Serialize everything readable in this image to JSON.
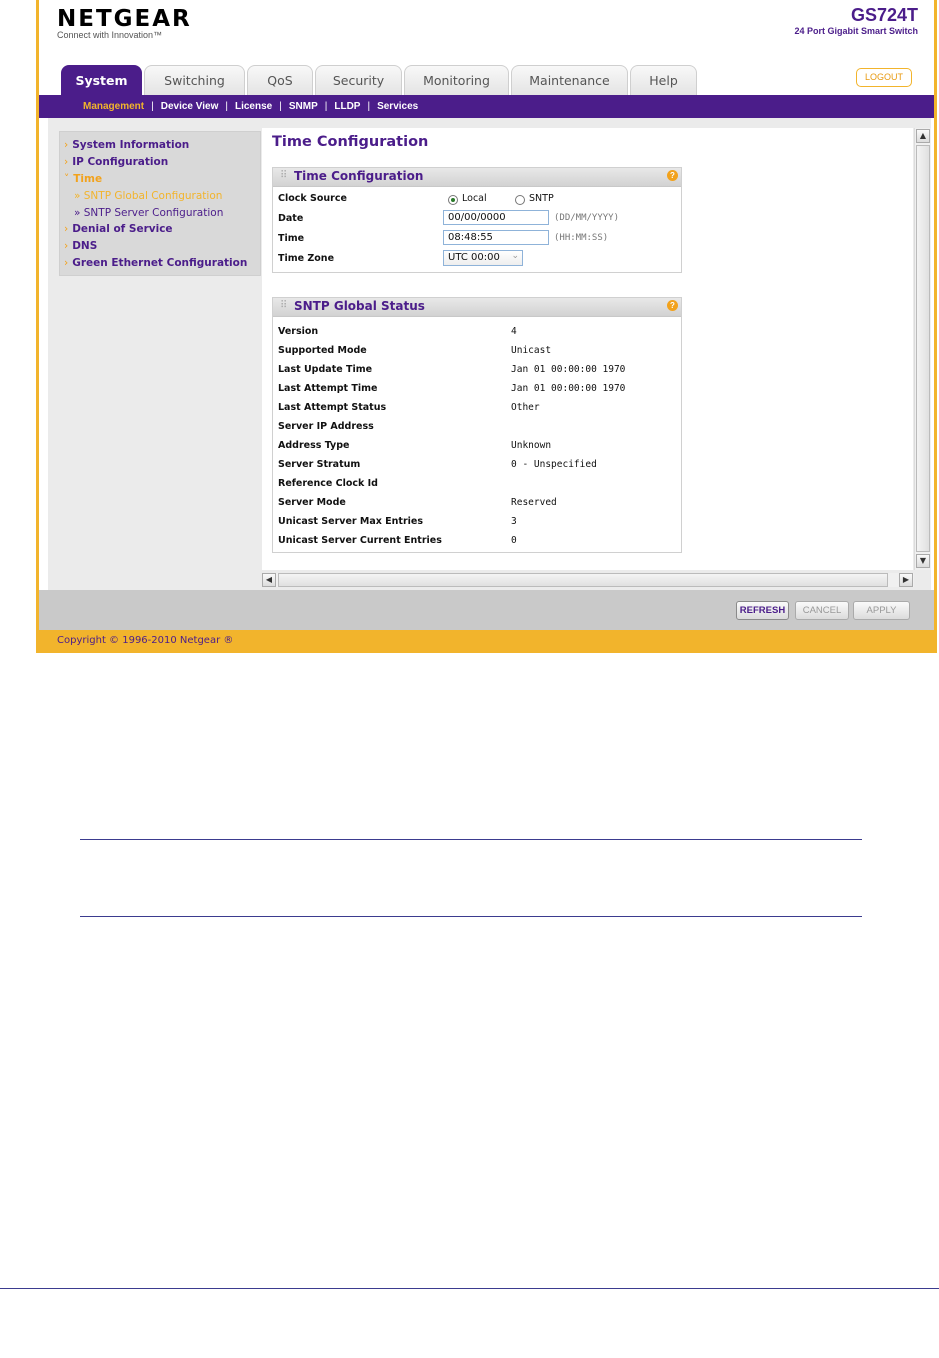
{
  "header": {
    "logo": "NETGEAR",
    "tagline": "Connect with Innovation™",
    "model": "GS724T",
    "model_desc": "24 Port Gigabit Smart Switch",
    "logout": "LOGOUT"
  },
  "tabs": [
    "System",
    "Switching",
    "QoS",
    "Security",
    "Monitoring",
    "Maintenance",
    "Help"
  ],
  "subnav": [
    "Management",
    "Device View",
    "License",
    "SNMP",
    "LLDP",
    "Services"
  ],
  "leftnav": {
    "system_info": "System Information",
    "ip_config": "IP Configuration",
    "time": "Time",
    "sntp_global": "» SNTP Global Configuration",
    "sntp_server": "» SNTP Server Configuration",
    "dos": "Denial of Service",
    "dns": "DNS",
    "green": "Green Ethernet Configuration"
  },
  "page_title": "Time Configuration",
  "time_config": {
    "title": "Time Configuration",
    "clock_source_label": "Clock Source",
    "local": "Local",
    "sntp": "SNTP",
    "date_label": "Date",
    "date_value": "00/00/0000",
    "date_hint": "(DD/MM/YYYY)",
    "time_label": "Time",
    "time_value": "08:48:55",
    "time_hint": "(HH:MM:SS)",
    "tz_label": "Time Zone",
    "tz_value": "UTC 00:00"
  },
  "sntp_status": {
    "title": "SNTP Global Status",
    "rows": [
      {
        "label": "Version",
        "value": "4"
      },
      {
        "label": "Supported Mode",
        "value": "Unicast"
      },
      {
        "label": "Last Update Time",
        "value": "Jan 01 00:00:00 1970"
      },
      {
        "label": "Last Attempt Time",
        "value": "Jan 01 00:00:00 1970"
      },
      {
        "label": "Last Attempt Status",
        "value": "Other"
      },
      {
        "label": "Server IP Address",
        "value": ""
      },
      {
        "label": "Address Type",
        "value": "Unknown"
      },
      {
        "label": "Server Stratum",
        "value": "0 - Unspecified"
      },
      {
        "label": "Reference Clock Id",
        "value": ""
      },
      {
        "label": "Server Mode",
        "value": "Reserved"
      },
      {
        "label": "Unicast Server Max Entries",
        "value": "3"
      },
      {
        "label": "Unicast Server Current Entries",
        "value": "0"
      }
    ]
  },
  "buttons": {
    "refresh": "REFRESH",
    "cancel": "CANCEL",
    "apply": "APPLY"
  },
  "copyright": "Copyright © 1996-2010 Netgear ®",
  "colors": {
    "brand_purple": "#4b1d8a",
    "accent_orange": "#f2b42c"
  }
}
